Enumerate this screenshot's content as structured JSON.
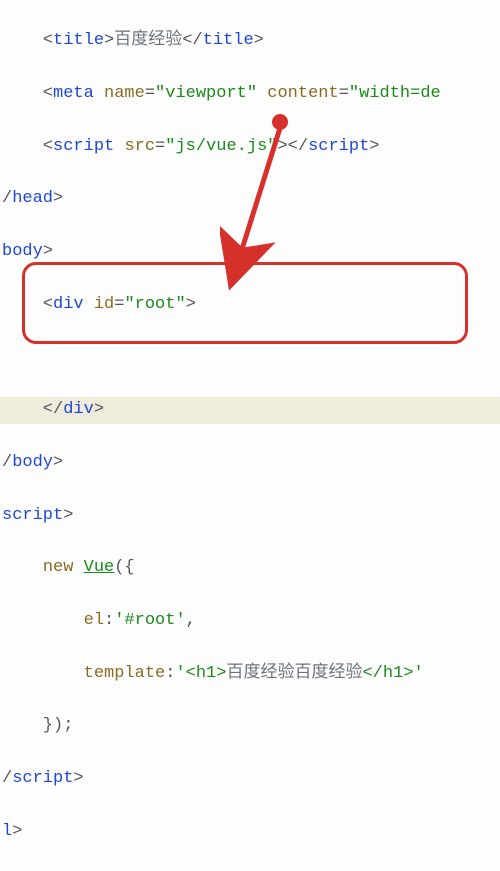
{
  "code": {
    "l1_a": "    <",
    "l1_b": "title",
    "l1_c": ">",
    "l1_d": "百度经验",
    "l1_e": "</",
    "l1_f": "title",
    "l1_g": ">",
    "l2_a": "    <",
    "l2_b": "meta",
    "l2_c": " ",
    "l2_d": "name",
    "l2_e": "=",
    "l2_f": "\"viewport\"",
    "l2_g": " ",
    "l2_h": "content",
    "l2_i": "=",
    "l2_j": "\"width=de",
    "l3_a": "    <",
    "l3_b": "script",
    "l3_c": " ",
    "l3_d": "src",
    "l3_e": "=",
    "l3_f": "\"js/vue.js\"",
    "l3_g": "></",
    "l3_h": "script",
    "l3_i": ">",
    "l4_a": "/",
    "l4_b": "head",
    "l4_c": ">",
    "l5_a": "body",
    "l5_b": ">",
    "l6_a": "    <",
    "l6_b": "div",
    "l6_c": " ",
    "l6_d": "id",
    "l6_e": "=",
    "l6_f": "\"root\"",
    "l6_g": ">",
    "l7": " ",
    "l8_a": "    </",
    "l8_b": "div",
    "l8_c": ">",
    "l9_a": "/",
    "l9_b": "body",
    "l9_c": ">",
    "l10_a": "script",
    "l10_b": ">",
    "l11_a": "    ",
    "l11_b": "new",
    "l11_c": " ",
    "l11_d": "Vue",
    "l11_e": "({",
    "l12_a": "        ",
    "l12_b": "el",
    "l12_c": ":",
    "l12_d": "'#root'",
    "l12_e": ",",
    "l13_a": "        ",
    "l13_b": "template",
    "l13_c": ":",
    "l13_d": "'<h1>",
    "l13_e": "百度经验百度经验",
    "l13_f": "</h1>'",
    "l14": "    });",
    "l15_a": "/",
    "l15_b": "script",
    "l15_c": ">",
    "l16_a": "l",
    "l16_b": ">"
  },
  "annotation": {
    "arrow_color": "#d6302a",
    "box_color": "#d6302a"
  }
}
